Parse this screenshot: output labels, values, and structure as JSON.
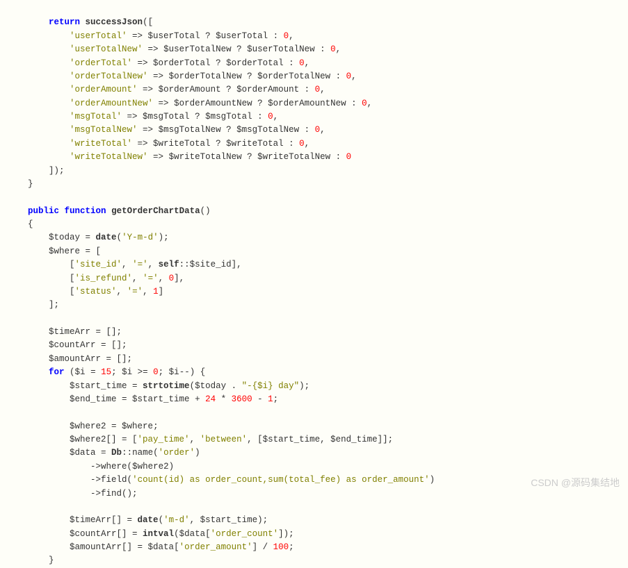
{
  "code": {
    "l01_return": "return",
    "l01_fn": "successJson",
    "l02_key": "'userTotal'",
    "l02_var": "$userTotal",
    "l02_var2": "$userTotal",
    "l02_zero": "0",
    "l03_key": "'userTotalNew'",
    "l03_var": "$userTotalNew",
    "l03_var2": "$userTotalNew",
    "l03_zero": "0",
    "l04_key": "'orderTotal'",
    "l04_var": "$orderTotal",
    "l04_var2": "$orderTotal",
    "l04_zero": "0",
    "l05_key": "'orderTotalNew'",
    "l05_var": "$orderTotalNew",
    "l05_var2": "$orderTotalNew",
    "l05_zero": "0",
    "l06_key": "'orderAmount'",
    "l06_var": "$orderAmount",
    "l06_var2": "$orderAmount",
    "l06_zero": "0",
    "l07_key": "'orderAmountNew'",
    "l07_var": "$orderAmountNew",
    "l07_var2": "$orderAmountNew",
    "l07_zero": "0",
    "l08_key": "'msgTotal'",
    "l08_var": "$msgTotal",
    "l08_var2": "$msgTotal",
    "l08_zero": "0",
    "l09_key": "'msgTotalNew'",
    "l09_var": "$msgTotalNew",
    "l09_var2": "$msgTotalNew",
    "l09_zero": "0",
    "l10_key": "'writeTotal'",
    "l10_var": "$writeTotal",
    "l10_var2": "$writeTotal",
    "l10_zero": "0",
    "l11_key": "'writeTotalNew'",
    "l11_var": "$writeTotalNew",
    "l11_var2": "$writeTotalNew",
    "l11_zero": "0",
    "l15_public": "public",
    "l15_function": "function",
    "l15_fn": "getOrderChartData",
    "l17_var": "$today",
    "l17_fn": "date",
    "l17_str": "'Y-m-d'",
    "l18_var": "$where",
    "l19_key": "'site_id'",
    "l19_op": "'='",
    "l19_self": "self",
    "l19_sid": "$site_id",
    "l20_key": "'is_refund'",
    "l20_op": "'='",
    "l20_val": "0",
    "l21_key": "'status'",
    "l21_op": "'='",
    "l21_val": "1",
    "l24_var": "$timeArr",
    "l25_var": "$countArr",
    "l26_var": "$amountArr",
    "l27_for": "for",
    "l27_i": "$i",
    "l27_15": "15",
    "l27_0": "0",
    "l28_var": "$start_time",
    "l28_fn": "strtotime",
    "l28_today": "$today",
    "l28_str": "\"-{$i} day\"",
    "l29_var": "$end_time",
    "l29_start": "$start_time",
    "l29_24": "24",
    "l29_3600": "3600",
    "l29_1": "1",
    "l31_var": "$where2",
    "l31_where": "$where",
    "l32_var": "$where2",
    "l32_key": "'pay_time'",
    "l32_bet": "'between'",
    "l32_start": "$start_time",
    "l32_end": "$end_time",
    "l33_var": "$data",
    "l33_db": "Db",
    "l33_name": "name",
    "l33_order": "'order'",
    "l34_where": "where",
    "l34_w2": "$where2",
    "l35_field": "field",
    "l35_str": "'count(id) as order_count,sum(total_fee) as order_amount'",
    "l36_find": "find",
    "l38_var": "$timeArr",
    "l38_fn": "date",
    "l38_str": "'m-d'",
    "l38_start": "$start_time",
    "l39_var": "$countArr",
    "l39_fn": "intval",
    "l39_data": "$data",
    "l39_key": "'order_count'",
    "l40_var": "$amountArr",
    "l40_data": "$data",
    "l40_key": "'order_amount'",
    "l40_100": "100"
  },
  "watermark": "CSDN @源码集结地"
}
